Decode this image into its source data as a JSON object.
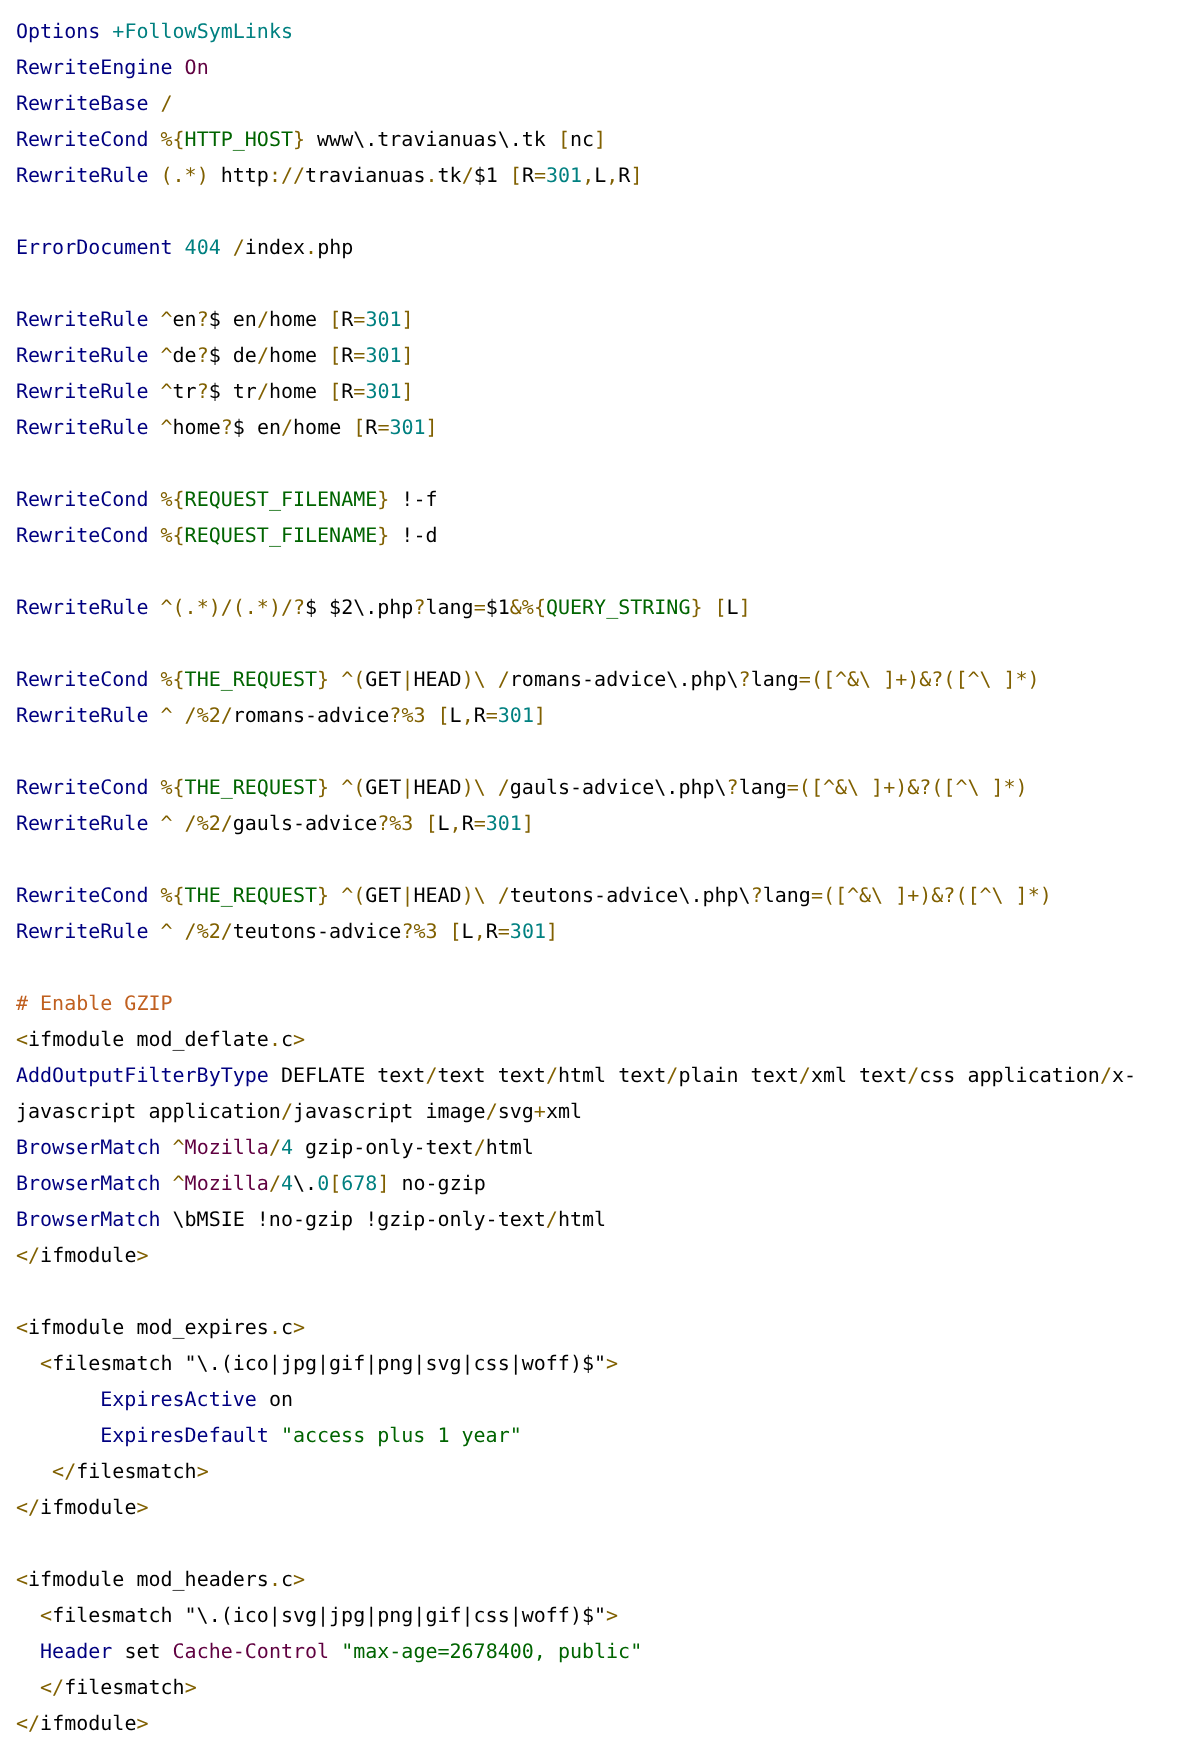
{
  "blocks": [
    {
      "lines": [
        {
          "tokens": [
            {
              "text": "Options",
              "kind": "kw"
            },
            {
              "text": " +FollowSymLinks",
              "kind": "num"
            }
          ]
        },
        {
          "tokens": [
            {
              "text": "RewriteEngine",
              "kind": "kw"
            },
            {
              "text": " On",
              "kind": "val"
            }
          ]
        },
        {
          "tokens": [
            {
              "text": "RewriteBase",
              "kind": "kw"
            },
            {
              "text": " /",
              "kind": "op"
            }
          ]
        },
        {
          "tokens": [
            {
              "text": "RewriteCond",
              "kind": "kw"
            },
            {
              "text": " %{",
              "kind": "op"
            },
            {
              "text": "HTTP_HOST",
              "kind": "str"
            },
            {
              "text": "} ",
              "kind": "op"
            },
            {
              "text": "www\\.travianuas\\.tk ",
              "kind": "txt"
            },
            {
              "text": "[",
              "kind": "op"
            },
            {
              "text": "nc",
              "kind": "txt"
            },
            {
              "text": "]",
              "kind": "op"
            }
          ]
        },
        {
          "tokens": [
            {
              "text": "RewriteRule",
              "kind": "kw"
            },
            {
              "text": " (.*)",
              "kind": "op"
            },
            {
              "text": " http",
              "kind": "txt"
            },
            {
              "text": "://",
              "kind": "op"
            },
            {
              "text": "travianuas",
              "kind": "txt"
            },
            {
              "text": ".",
              "kind": "op"
            },
            {
              "text": "tk",
              "kind": "txt"
            },
            {
              "text": "/",
              "kind": "op"
            },
            {
              "text": "$1 ",
              "kind": "txt"
            },
            {
              "text": "[",
              "kind": "op"
            },
            {
              "text": "R",
              "kind": "txt"
            },
            {
              "text": "=",
              "kind": "op"
            },
            {
              "text": "301",
              "kind": "num"
            },
            {
              "text": ",",
              "kind": "op"
            },
            {
              "text": "L",
              "kind": "txt"
            },
            {
              "text": ",",
              "kind": "op"
            },
            {
              "text": "R",
              "kind": "txt"
            },
            {
              "text": "]",
              "kind": "op"
            }
          ]
        }
      ]
    },
    {
      "lines": [
        {
          "tokens": [
            {
              "text": "ErrorDocument",
              "kind": "kw"
            },
            {
              "text": " 404",
              "kind": "num"
            },
            {
              "text": " /",
              "kind": "op"
            },
            {
              "text": "index",
              "kind": "txt"
            },
            {
              "text": ".",
              "kind": "op"
            },
            {
              "text": "php",
              "kind": "txt"
            }
          ]
        }
      ]
    },
    {
      "lines": [
        {
          "tokens": [
            {
              "text": "RewriteRule",
              "kind": "kw"
            },
            {
              "text": " ^",
              "kind": "op"
            },
            {
              "text": "en",
              "kind": "txt"
            },
            {
              "text": "?",
              "kind": "op"
            },
            {
              "text": "$ en",
              "kind": "txt"
            },
            {
              "text": "/",
              "kind": "op"
            },
            {
              "text": "home ",
              "kind": "txt"
            },
            {
              "text": "[",
              "kind": "op"
            },
            {
              "text": "R",
              "kind": "txt"
            },
            {
              "text": "=",
              "kind": "op"
            },
            {
              "text": "301",
              "kind": "num"
            },
            {
              "text": "]",
              "kind": "op"
            }
          ]
        },
        {
          "tokens": [
            {
              "text": "RewriteRule",
              "kind": "kw"
            },
            {
              "text": " ^",
              "kind": "op"
            },
            {
              "text": "de",
              "kind": "txt"
            },
            {
              "text": "?",
              "kind": "op"
            },
            {
              "text": "$ de",
              "kind": "txt"
            },
            {
              "text": "/",
              "kind": "op"
            },
            {
              "text": "home ",
              "kind": "txt"
            },
            {
              "text": "[",
              "kind": "op"
            },
            {
              "text": "R",
              "kind": "txt"
            },
            {
              "text": "=",
              "kind": "op"
            },
            {
              "text": "301",
              "kind": "num"
            },
            {
              "text": "]",
              "kind": "op"
            }
          ]
        },
        {
          "tokens": [
            {
              "text": "RewriteRule",
              "kind": "kw"
            },
            {
              "text": " ^",
              "kind": "op"
            },
            {
              "text": "tr",
              "kind": "txt"
            },
            {
              "text": "?",
              "kind": "op"
            },
            {
              "text": "$ tr",
              "kind": "txt"
            },
            {
              "text": "/",
              "kind": "op"
            },
            {
              "text": "home ",
              "kind": "txt"
            },
            {
              "text": "[",
              "kind": "op"
            },
            {
              "text": "R",
              "kind": "txt"
            },
            {
              "text": "=",
              "kind": "op"
            },
            {
              "text": "301",
              "kind": "num"
            },
            {
              "text": "]",
              "kind": "op"
            }
          ]
        },
        {
          "tokens": [
            {
              "text": "RewriteRule",
              "kind": "kw"
            },
            {
              "text": " ^",
              "kind": "op"
            },
            {
              "text": "home",
              "kind": "txt"
            },
            {
              "text": "?",
              "kind": "op"
            },
            {
              "text": "$ en",
              "kind": "txt"
            },
            {
              "text": "/",
              "kind": "op"
            },
            {
              "text": "home ",
              "kind": "txt"
            },
            {
              "text": "[",
              "kind": "op"
            },
            {
              "text": "R",
              "kind": "txt"
            },
            {
              "text": "=",
              "kind": "op"
            },
            {
              "text": "301",
              "kind": "num"
            },
            {
              "text": "]",
              "kind": "op"
            }
          ]
        }
      ]
    },
    {
      "lines": [
        {
          "tokens": [
            {
              "text": "RewriteCond",
              "kind": "kw"
            },
            {
              "text": " %{",
              "kind": "op"
            },
            {
              "text": "REQUEST_FILENAME",
              "kind": "str"
            },
            {
              "text": "} ",
              "kind": "op"
            },
            {
              "text": "!-f",
              "kind": "txt"
            }
          ]
        },
        {
          "tokens": [
            {
              "text": "RewriteCond",
              "kind": "kw"
            },
            {
              "text": " %{",
              "kind": "op"
            },
            {
              "text": "REQUEST_FILENAME",
              "kind": "str"
            },
            {
              "text": "} ",
              "kind": "op"
            },
            {
              "text": "!-d",
              "kind": "txt"
            }
          ]
        }
      ]
    },
    {
      "lines": [
        {
          "tokens": [
            {
              "text": "RewriteRule",
              "kind": "kw"
            },
            {
              "text": " ^(.*)/(.*)/?",
              "kind": "op"
            },
            {
              "text": "$ $2\\.php",
              "kind": "txt"
            },
            {
              "text": "?",
              "kind": "op"
            },
            {
              "text": "lang",
              "kind": "txt"
            },
            {
              "text": "=",
              "kind": "op"
            },
            {
              "text": "$1",
              "kind": "txt"
            },
            {
              "text": "&%{",
              "kind": "op"
            },
            {
              "text": "QUERY_STRING",
              "kind": "str"
            },
            {
              "text": "} [",
              "kind": "op"
            },
            {
              "text": "L",
              "kind": "txt"
            },
            {
              "text": "]",
              "kind": "op"
            }
          ]
        }
      ]
    },
    {
      "lines": [
        {
          "tokens": [
            {
              "text": "RewriteCond",
              "kind": "kw"
            },
            {
              "text": " %{",
              "kind": "op"
            },
            {
              "text": "THE_REQUEST",
              "kind": "str"
            },
            {
              "text": "} ^(",
              "kind": "op"
            },
            {
              "text": "GET",
              "kind": "txt"
            },
            {
              "text": "|",
              "kind": "op"
            },
            {
              "text": "HEAD",
              "kind": "txt"
            },
            {
              "text": ")\\ /",
              "kind": "op"
            },
            {
              "text": "romans-advice\\.php\\",
              "kind": "txt"
            },
            {
              "text": "?",
              "kind": "op"
            },
            {
              "text": "lang",
              "kind": "txt"
            },
            {
              "text": "=([^&\\ ]+)&?([^\\ ]*)",
              "kind": "op"
            }
          ]
        },
        {
          "tokens": [
            {
              "text": "RewriteRule",
              "kind": "kw"
            },
            {
              "text": " ^ /%2/",
              "kind": "op"
            },
            {
              "text": "romans-advice",
              "kind": "txt"
            },
            {
              "text": "?%3 [",
              "kind": "op"
            },
            {
              "text": "L",
              "kind": "txt"
            },
            {
              "text": ",",
              "kind": "op"
            },
            {
              "text": "R",
              "kind": "txt"
            },
            {
              "text": "=",
              "kind": "op"
            },
            {
              "text": "301",
              "kind": "num"
            },
            {
              "text": "]",
              "kind": "op"
            }
          ]
        }
      ]
    },
    {
      "lines": [
        {
          "tokens": [
            {
              "text": "RewriteCond",
              "kind": "kw"
            },
            {
              "text": " %{",
              "kind": "op"
            },
            {
              "text": "THE_REQUEST",
              "kind": "str"
            },
            {
              "text": "} ^(",
              "kind": "op"
            },
            {
              "text": "GET",
              "kind": "txt"
            },
            {
              "text": "|",
              "kind": "op"
            },
            {
              "text": "HEAD",
              "kind": "txt"
            },
            {
              "text": ")\\ /",
              "kind": "op"
            },
            {
              "text": "gauls-advice\\.php\\",
              "kind": "txt"
            },
            {
              "text": "?",
              "kind": "op"
            },
            {
              "text": "lang",
              "kind": "txt"
            },
            {
              "text": "=([^&\\ ]+)&?([^\\ ]*)",
              "kind": "op"
            }
          ]
        },
        {
          "tokens": [
            {
              "text": "RewriteRule",
              "kind": "kw"
            },
            {
              "text": " ^ /%2/",
              "kind": "op"
            },
            {
              "text": "gauls-advice",
              "kind": "txt"
            },
            {
              "text": "?%3 [",
              "kind": "op"
            },
            {
              "text": "L",
              "kind": "txt"
            },
            {
              "text": ",",
              "kind": "op"
            },
            {
              "text": "R",
              "kind": "txt"
            },
            {
              "text": "=",
              "kind": "op"
            },
            {
              "text": "301",
              "kind": "num"
            },
            {
              "text": "]",
              "kind": "op"
            }
          ]
        }
      ]
    },
    {
      "lines": [
        {
          "tokens": [
            {
              "text": "RewriteCond",
              "kind": "kw"
            },
            {
              "text": " %{",
              "kind": "op"
            },
            {
              "text": "THE_REQUEST",
              "kind": "str"
            },
            {
              "text": "} ^(",
              "kind": "op"
            },
            {
              "text": "GET",
              "kind": "txt"
            },
            {
              "text": "|",
              "kind": "op"
            },
            {
              "text": "HEAD",
              "kind": "txt"
            },
            {
              "text": ")\\ /",
              "kind": "op"
            },
            {
              "text": "teutons-advice\\.php\\",
              "kind": "txt"
            },
            {
              "text": "?",
              "kind": "op"
            },
            {
              "text": "lang",
              "kind": "txt"
            },
            {
              "text": "=([^&\\ ]+)&?([^\\ ]*)",
              "kind": "op"
            }
          ]
        },
        {
          "tokens": [
            {
              "text": "RewriteRule",
              "kind": "kw"
            },
            {
              "text": " ^ /%2/",
              "kind": "op"
            },
            {
              "text": "teutons-advice",
              "kind": "txt"
            },
            {
              "text": "?%3 [",
              "kind": "op"
            },
            {
              "text": "L",
              "kind": "txt"
            },
            {
              "text": ",",
              "kind": "op"
            },
            {
              "text": "R",
              "kind": "txt"
            },
            {
              "text": "=",
              "kind": "op"
            },
            {
              "text": "301",
              "kind": "num"
            },
            {
              "text": "]",
              "kind": "op"
            }
          ]
        }
      ]
    },
    {
      "lines": [
        {
          "tokens": [
            {
              "text": "# Enable GZIP",
              "kind": "cmt"
            }
          ]
        },
        {
          "tokens": [
            {
              "text": "<",
              "kind": "op"
            },
            {
              "text": "ifmodule mod_deflate",
              "kind": "txt"
            },
            {
              "text": ".",
              "kind": "op"
            },
            {
              "text": "c",
              "kind": "txt"
            },
            {
              "text": ">",
              "kind": "op"
            }
          ]
        },
        {
          "tokens": [
            {
              "text": "AddOutputFilterByType",
              "kind": "kw"
            },
            {
              "text": " DEFLATE text",
              "kind": "txt"
            },
            {
              "text": "/",
              "kind": "op"
            },
            {
              "text": "text text",
              "kind": "txt"
            },
            {
              "text": "/",
              "kind": "op"
            },
            {
              "text": "html text",
              "kind": "txt"
            },
            {
              "text": "/",
              "kind": "op"
            },
            {
              "text": "plain text",
              "kind": "txt"
            },
            {
              "text": "/",
              "kind": "op"
            },
            {
              "text": "xml text",
              "kind": "txt"
            },
            {
              "text": "/",
              "kind": "op"
            },
            {
              "text": "css application",
              "kind": "txt"
            },
            {
              "text": "/",
              "kind": "op"
            },
            {
              "text": "x-",
              "kind": "txt"
            }
          ]
        },
        {
          "tokens": [
            {
              "text": "javascript application",
              "kind": "txt"
            },
            {
              "text": "/",
              "kind": "op"
            },
            {
              "text": "javascript image",
              "kind": "txt"
            },
            {
              "text": "/",
              "kind": "op"
            },
            {
              "text": "svg",
              "kind": "txt"
            },
            {
              "text": "+",
              "kind": "op"
            },
            {
              "text": "xml",
              "kind": "txt"
            }
          ]
        },
        {
          "tokens": [
            {
              "text": "BrowserMatch",
              "kind": "kw"
            },
            {
              "text": " ^",
              "kind": "op"
            },
            {
              "text": "Mozilla",
              "kind": "val"
            },
            {
              "text": "/",
              "kind": "op"
            },
            {
              "text": "4",
              "kind": "num"
            },
            {
              "text": " gzip-only-text",
              "kind": "txt"
            },
            {
              "text": "/",
              "kind": "op"
            },
            {
              "text": "html",
              "kind": "txt"
            }
          ]
        },
        {
          "tokens": [
            {
              "text": "BrowserMatch",
              "kind": "kw"
            },
            {
              "text": " ^",
              "kind": "op"
            },
            {
              "text": "Mozilla",
              "kind": "val"
            },
            {
              "text": "/",
              "kind": "op"
            },
            {
              "text": "4",
              "kind": "num"
            },
            {
              "text": "\\.",
              "kind": "txt"
            },
            {
              "text": "0",
              "kind": "num"
            },
            {
              "text": "[",
              "kind": "op"
            },
            {
              "text": "678",
              "kind": "num"
            },
            {
              "text": "]",
              "kind": "op"
            },
            {
              "text": " no-gzip",
              "kind": "txt"
            }
          ]
        },
        {
          "tokens": [
            {
              "text": "BrowserMatch",
              "kind": "kw"
            },
            {
              "text": " \\bMSIE !no-gzip !gzip-only-text",
              "kind": "txt"
            },
            {
              "text": "/",
              "kind": "op"
            },
            {
              "text": "html",
              "kind": "txt"
            }
          ]
        },
        {
          "tokens": [
            {
              "text": "</",
              "kind": "op"
            },
            {
              "text": "ifmodule",
              "kind": "txt"
            },
            {
              "text": ">",
              "kind": "op"
            }
          ]
        }
      ]
    },
    {
      "lines": [
        {
          "tokens": [
            {
              "text": "<",
              "kind": "op"
            },
            {
              "text": "ifmodule mod_expires",
              "kind": "txt"
            },
            {
              "text": ".",
              "kind": "op"
            },
            {
              "text": "c",
              "kind": "txt"
            },
            {
              "text": ">",
              "kind": "op"
            }
          ]
        },
        {
          "tokens": [
            {
              "text": "  <",
              "kind": "op"
            },
            {
              "text": "filesmatch \"\\.(ico|jpg|gif|png|svg|css|woff)$\"",
              "kind": "txt"
            },
            {
              "text": ">",
              "kind": "op"
            }
          ]
        },
        {
          "tokens": [
            {
              "text": "       ExpiresActive",
              "kind": "kw"
            },
            {
              "text": " on",
              "kind": "txt"
            }
          ]
        },
        {
          "tokens": [
            {
              "text": "       ExpiresDefault",
              "kind": "kw"
            },
            {
              "text": " \"access plus 1 year\"",
              "kind": "str"
            }
          ]
        },
        {
          "tokens": [
            {
              "text": "   </",
              "kind": "op"
            },
            {
              "text": "filesmatch",
              "kind": "txt"
            },
            {
              "text": ">",
              "kind": "op"
            }
          ]
        },
        {
          "tokens": [
            {
              "text": "</",
              "kind": "op"
            },
            {
              "text": "ifmodule",
              "kind": "txt"
            },
            {
              "text": ">",
              "kind": "op"
            }
          ]
        }
      ]
    },
    {
      "lines": [
        {
          "tokens": [
            {
              "text": "<",
              "kind": "op"
            },
            {
              "text": "ifmodule mod_headers",
              "kind": "txt"
            },
            {
              "text": ".",
              "kind": "op"
            },
            {
              "text": "c",
              "kind": "txt"
            },
            {
              "text": ">",
              "kind": "op"
            }
          ]
        },
        {
          "tokens": [
            {
              "text": "  <",
              "kind": "op"
            },
            {
              "text": "filesmatch \"\\.(ico|svg|jpg|png|gif|css|woff)$\"",
              "kind": "txt"
            },
            {
              "text": ">",
              "kind": "op"
            }
          ]
        },
        {
          "tokens": [
            {
              "text": "  Header",
              "kind": "kw"
            },
            {
              "text": " set ",
              "kind": "txt"
            },
            {
              "text": "Cache-Control",
              "kind": "val"
            },
            {
              "text": " \"max-age=2678400, public\"",
              "kind": "str"
            }
          ]
        },
        {
          "tokens": [
            {
              "text": "  </",
              "kind": "op"
            },
            {
              "text": "filesmatch",
              "kind": "txt"
            },
            {
              "text": ">",
              "kind": "op"
            }
          ]
        },
        {
          "tokens": [
            {
              "text": "</",
              "kind": "op"
            },
            {
              "text": "ifmodule",
              "kind": "txt"
            },
            {
              "text": ">",
              "kind": "op"
            }
          ]
        }
      ]
    }
  ]
}
